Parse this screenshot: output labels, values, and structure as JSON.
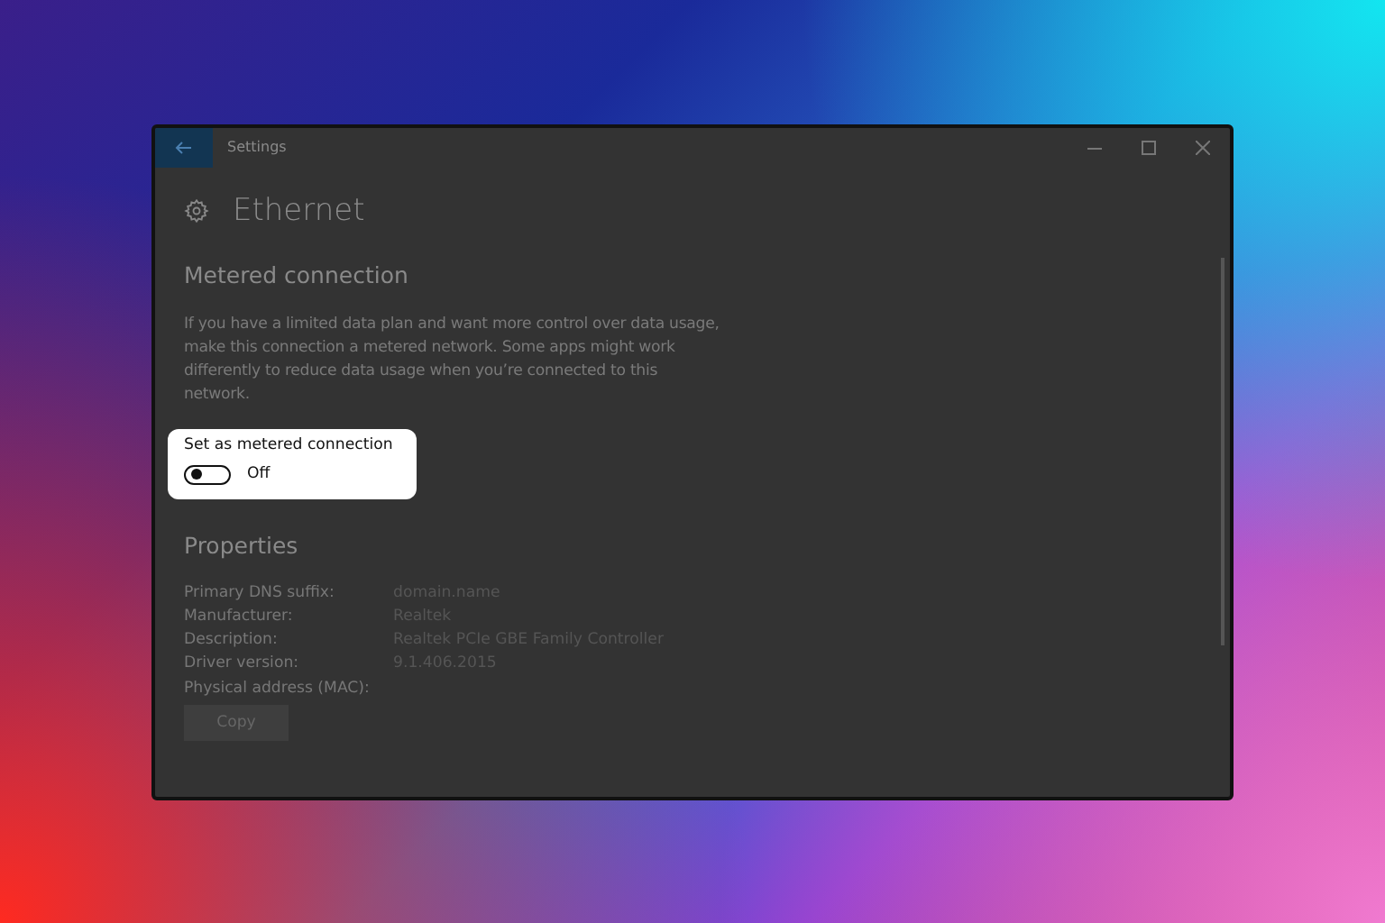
{
  "window": {
    "title": "Settings"
  },
  "page": {
    "title": "Ethernet"
  },
  "metered": {
    "heading": "Metered connection",
    "description": "If you have a limited data plan and want more control over data usage, make this connection a metered network. Some apps might work differently to reduce data usage when you’re connected to this network.",
    "toggle": {
      "label": "Set as metered connection",
      "on": false,
      "state_text": "Off"
    }
  },
  "properties": {
    "heading": "Properties",
    "rows": [
      {
        "label": "Primary DNS suffix:",
        "value": "domain.name"
      },
      {
        "label": "Manufacturer:",
        "value": "Realtek"
      },
      {
        "label": "Description:",
        "value": "Realtek PCIe GBE Family Controller"
      },
      {
        "label": "Driver version:",
        "value": "9.1.406.2015"
      },
      {
        "label": "Physical address (MAC):",
        "value": ""
      }
    ],
    "button": "Copy"
  }
}
